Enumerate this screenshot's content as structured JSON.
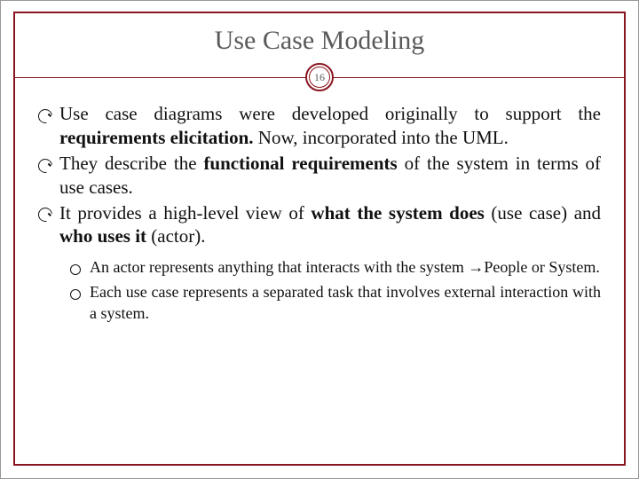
{
  "slide": {
    "title": "Use Case Modeling",
    "page_number": "16",
    "bullets": [
      {
        "pre": "Use case diagrams were developed originally to support the ",
        "bold1": "requirements elicitation.",
        "post1": "  Now, incorporated into the UML."
      },
      {
        "pre": "They describe the ",
        "bold1": "functional requirements",
        "post1": " of the system in terms of use cases."
      },
      {
        "pre": " It provides a high-level view of ",
        "bold1": "what the system does",
        "mid": " (use case) and ",
        "bold2": "who uses it",
        "post1": " (actor)."
      }
    ],
    "sub_bullets": [
      {
        "pre": "An actor represents anything that interacts with the system ",
        "arrow": "→",
        "post": "People or System."
      },
      {
        "text": "Each use case represents a separated task that involves external interaction with a system."
      }
    ]
  }
}
